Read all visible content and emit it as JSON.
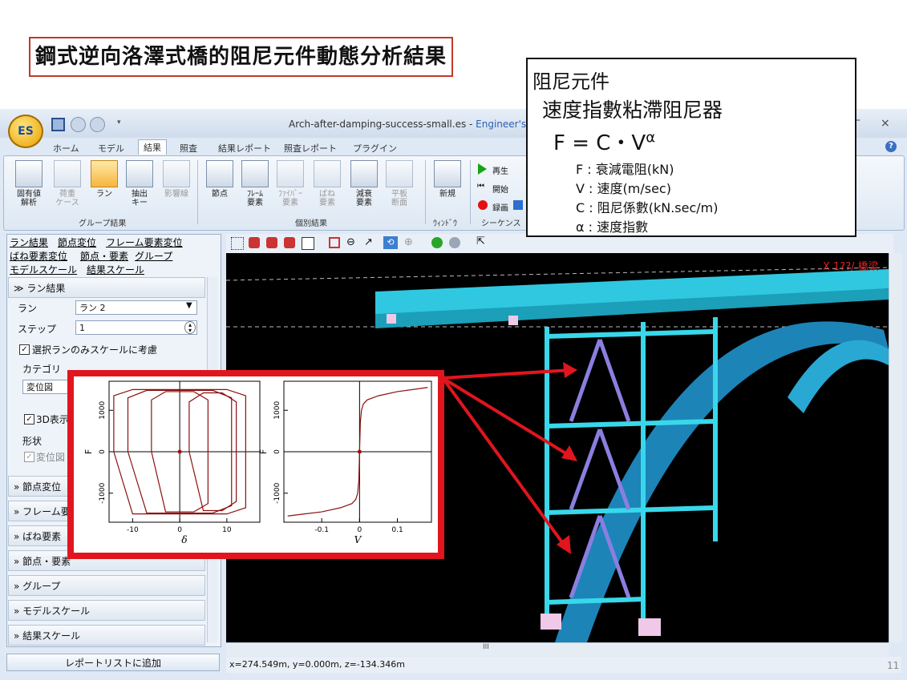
{
  "slide": {
    "title": "鋼式逆向洛澤式橋的阻尼元件動態分析結果",
    "page_number": "11"
  },
  "callout": {
    "line1": "阻尼元件",
    "line2": "速度指數粘滯阻尼器",
    "formula_main": "F = C・V",
    "formula_exp": "α",
    "defs": [
      "F : 衰減電阻(kN)",
      "V : 速度(m/sec)",
      "C : 阻尼係數(kN.sec/m)",
      "α : 速度指數"
    ]
  },
  "window": {
    "title_prefix": "Arch-after-damping-success-small.es - ",
    "title_brand": "Engineer's",
    "app_logo": "ES",
    "minimize": "–",
    "close": "×",
    "help": "?"
  },
  "tabs": [
    "ホーム",
    "モデル",
    "結果",
    "照査",
    "結果レポート",
    "照査レポート",
    "プラグイン"
  ],
  "ribbon": {
    "buttons": [
      {
        "label": "固有値\n解析",
        "icon": "eigen-icon"
      },
      {
        "label": "荷重\nケース",
        "icon": "load-case-icon"
      },
      {
        "label": "ラン",
        "icon": "run-icon"
      },
      {
        "label": "抽出\nキー",
        "icon": "extract-key-icon"
      },
      {
        "label": "影響線",
        "icon": "influence-line-icon"
      },
      {
        "label": "節点",
        "icon": "node-icon"
      },
      {
        "label": "ﾌﾚｰﾑ\n要素",
        "icon": "frame-element-icon"
      },
      {
        "label": "ﾌｧｲﾊﾞｰ\n要素",
        "icon": "fiber-element-icon"
      },
      {
        "label": "ばね\n要素",
        "icon": "spring-element-icon"
      },
      {
        "label": "減衰\n要素",
        "icon": "damping-element-icon"
      },
      {
        "label": "平板\n断面",
        "icon": "plate-section-icon"
      },
      {
        "label": "新規",
        "icon": "new-window-icon"
      }
    ],
    "groups": [
      "グループ結果",
      "個別結果",
      "ｳｨﾝﾄﾞｳ",
      "シーケンス"
    ],
    "sequence": {
      "play": "再生",
      "start": "開始",
      "record": "録画"
    }
  },
  "left_panel": {
    "links": [
      "ラン結果",
      "節点変位",
      "フレーム要素変位",
      "ばね要素変位",
      "節点・要素",
      "グループ",
      "モデルスケール",
      "結果スケール"
    ],
    "run_section": {
      "header": "ラン結果",
      "run_label": "ラン",
      "run_value": "ラン 2",
      "step_label": "ステップ",
      "step_value": "1",
      "scale_checkbox": "選択ランのみスケールに考慮",
      "category_label": "カテゴリ",
      "category_value": "変位図",
      "display_3d": "3D表示",
      "shape_label": "形状",
      "shape_value": "変位図"
    },
    "sections": [
      "節点変位",
      "フレーム要素",
      "ばね要素",
      "節点・要素",
      "グループ",
      "モデルスケール",
      "結果スケール"
    ],
    "report_button": "レポートリストに追加"
  },
  "viewport": {
    "label": "X 1??/ 橋梁",
    "status": "x=274.549m, y=0.000m, z=-134.346m",
    "hscroll_mark": "III"
  },
  "chart_data": [
    {
      "type": "line",
      "xlabel": "δ",
      "ylabel": "F",
      "x_ticks": [
        "-10",
        "0",
        "10"
      ],
      "y_ticks": [
        "-1000",
        "0",
        "1000"
      ],
      "xlim": [
        -15,
        17
      ],
      "ylim": [
        -1700,
        1700
      ],
      "grid": false,
      "series": [
        {
          "x": [
            -14,
            -14,
            -10,
            10,
            14,
            14,
            10,
            -10,
            -14
          ],
          "y": [
            0,
            1350,
            1500,
            1500,
            1350,
            -1350,
            -1500,
            -1500,
            0
          ]
        },
        {
          "x": [
            -11,
            -11,
            -7,
            7,
            11,
            11,
            7,
            -7,
            -11
          ],
          "y": [
            0,
            1300,
            1480,
            1480,
            1300,
            -1300,
            -1480,
            -1480,
            0
          ]
        },
        {
          "x": [
            -6,
            -6,
            -3,
            3,
            6,
            6,
            3,
            -3,
            -6
          ],
          "y": [
            0,
            1250,
            1450,
            1450,
            1250,
            -1250,
            -1450,
            -1450,
            0
          ]
        },
        {
          "x": [
            2,
            2,
            5,
            9,
            12,
            12,
            9,
            5,
            2
          ],
          "y": [
            0,
            1200,
            1420,
            1420,
            1200,
            -1200,
            -1420,
            -1420,
            0
          ]
        }
      ]
    },
    {
      "type": "line",
      "xlabel": "V",
      "ylabel": "F",
      "x_ticks": [
        "-0.1",
        "0",
        "0.1"
      ],
      "y_ticks": [
        "-1000",
        "0",
        "1000"
      ],
      "xlim": [
        -0.2,
        0.19
      ],
      "ylim": [
        -1700,
        1700
      ],
      "grid": false,
      "series": [
        {
          "x": [
            -0.19,
            -0.1,
            -0.05,
            -0.02,
            -0.01,
            -0.005,
            -0.002,
            0,
            0.002,
            0.005,
            0.01,
            0.02,
            0.05,
            0.1,
            0.18
          ],
          "y": [
            -1550,
            -1450,
            -1350,
            -1250,
            -1150,
            -1000,
            -700,
            0,
            700,
            1000,
            1150,
            1250,
            1350,
            1450,
            1550
          ]
        }
      ]
    }
  ]
}
